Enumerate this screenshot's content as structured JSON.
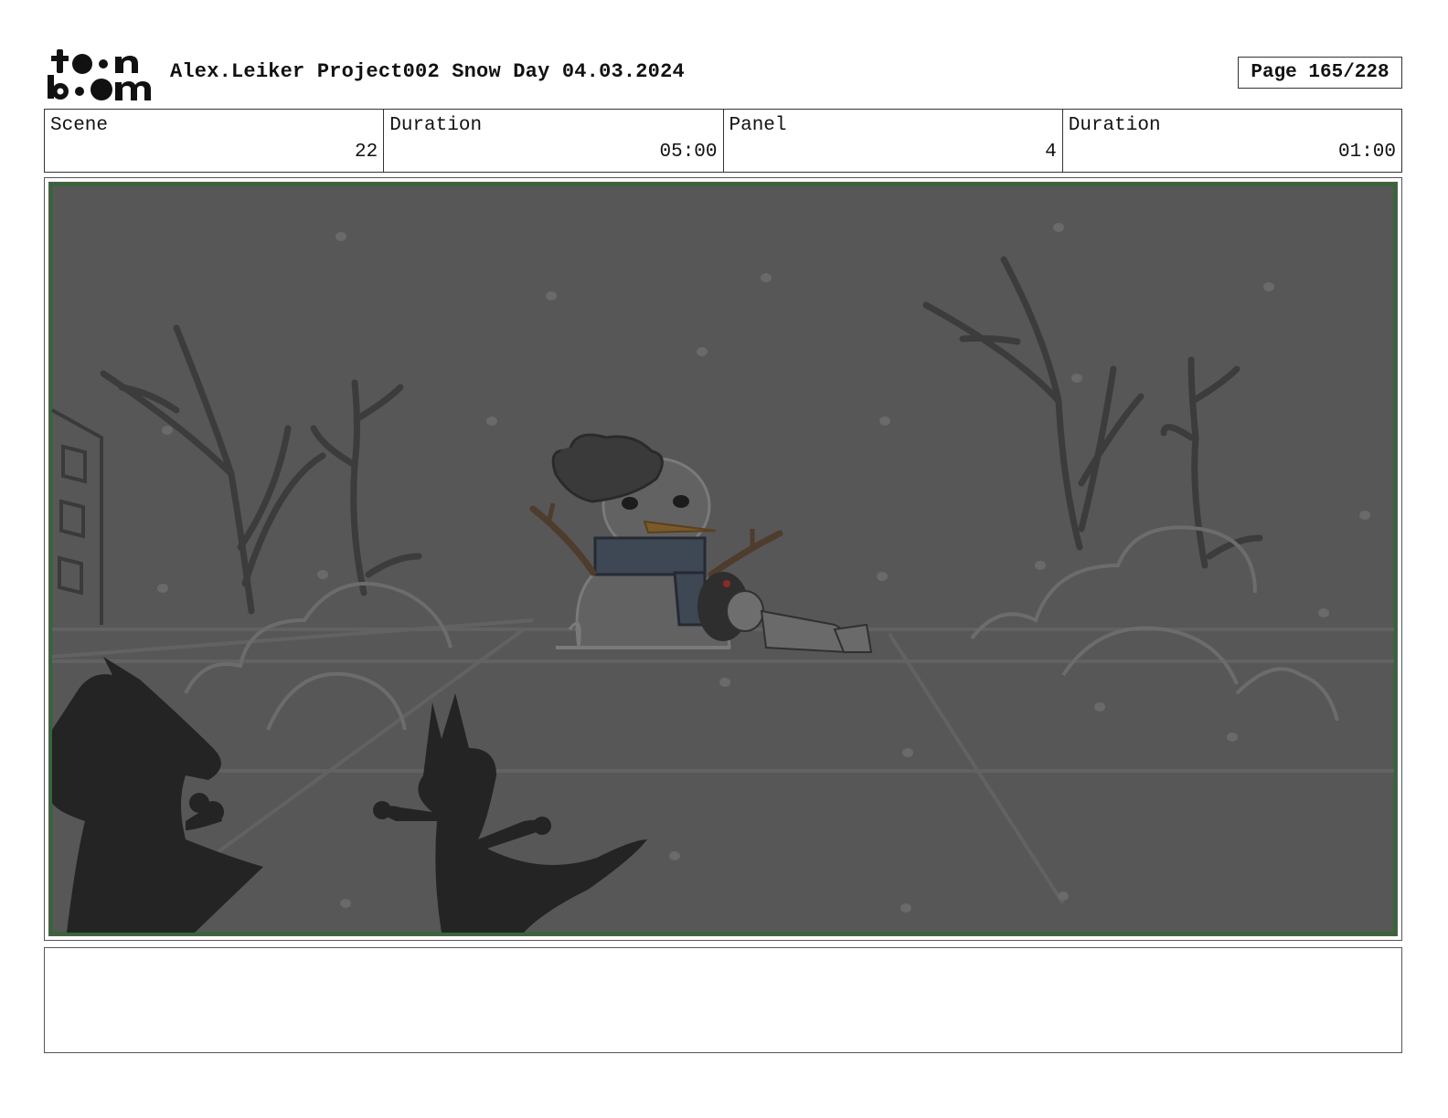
{
  "logo": {
    "text": "toon boom"
  },
  "header": {
    "title": "Alex.Leiker Project002 Snow Day 04.03.2024",
    "page_label": "Page 165/228"
  },
  "info": {
    "scene_label": "Scene",
    "scene_value": "22",
    "scene_duration_label": "Duration",
    "scene_duration_value": "05:00",
    "panel_label": "Panel",
    "panel_value": "4",
    "panel_duration_label": "Duration",
    "panel_duration_value": "01:00"
  },
  "caption": {
    "text": ""
  }
}
